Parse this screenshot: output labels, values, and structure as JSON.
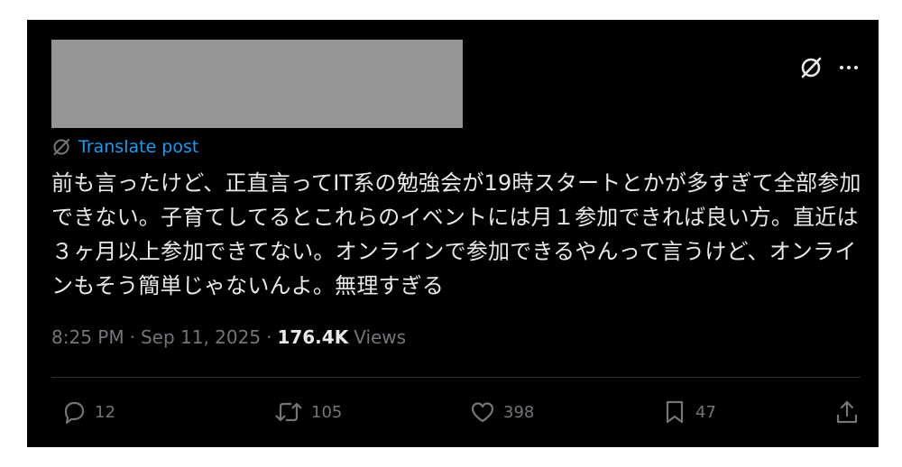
{
  "tweet": {
    "translate_label": "Translate post",
    "text": "前も言ったけど、正直言ってIT系の勉強会が19時スタートとかが多すぎて全部参加できない。子育てしてるとこれらのイベントには月１参加できれば良い方。直近は３ヶ月以上参加できてない。オンラインで参加できるやんって言うけど、オンラインもそう簡単じゃないんよ。無理すぎる",
    "time": "8:25 PM",
    "separator_1": "·",
    "date": "Sep 11, 2025",
    "separator_2": "·",
    "views_count": "176.4K",
    "views_label": "Views"
  },
  "actions": {
    "replies": "12",
    "reposts": "105",
    "likes": "398",
    "bookmarks": "47"
  },
  "colors": {
    "background": "#000000",
    "text": "#e7e9ea",
    "muted": "#71767b",
    "accent": "#1d9bf0",
    "redaction": "#959595"
  },
  "icons": [
    "grok-translate-icon",
    "more-icon",
    "translate-icon",
    "reply-icon",
    "repost-icon",
    "like-icon",
    "bookmark-icon",
    "share-icon"
  ]
}
